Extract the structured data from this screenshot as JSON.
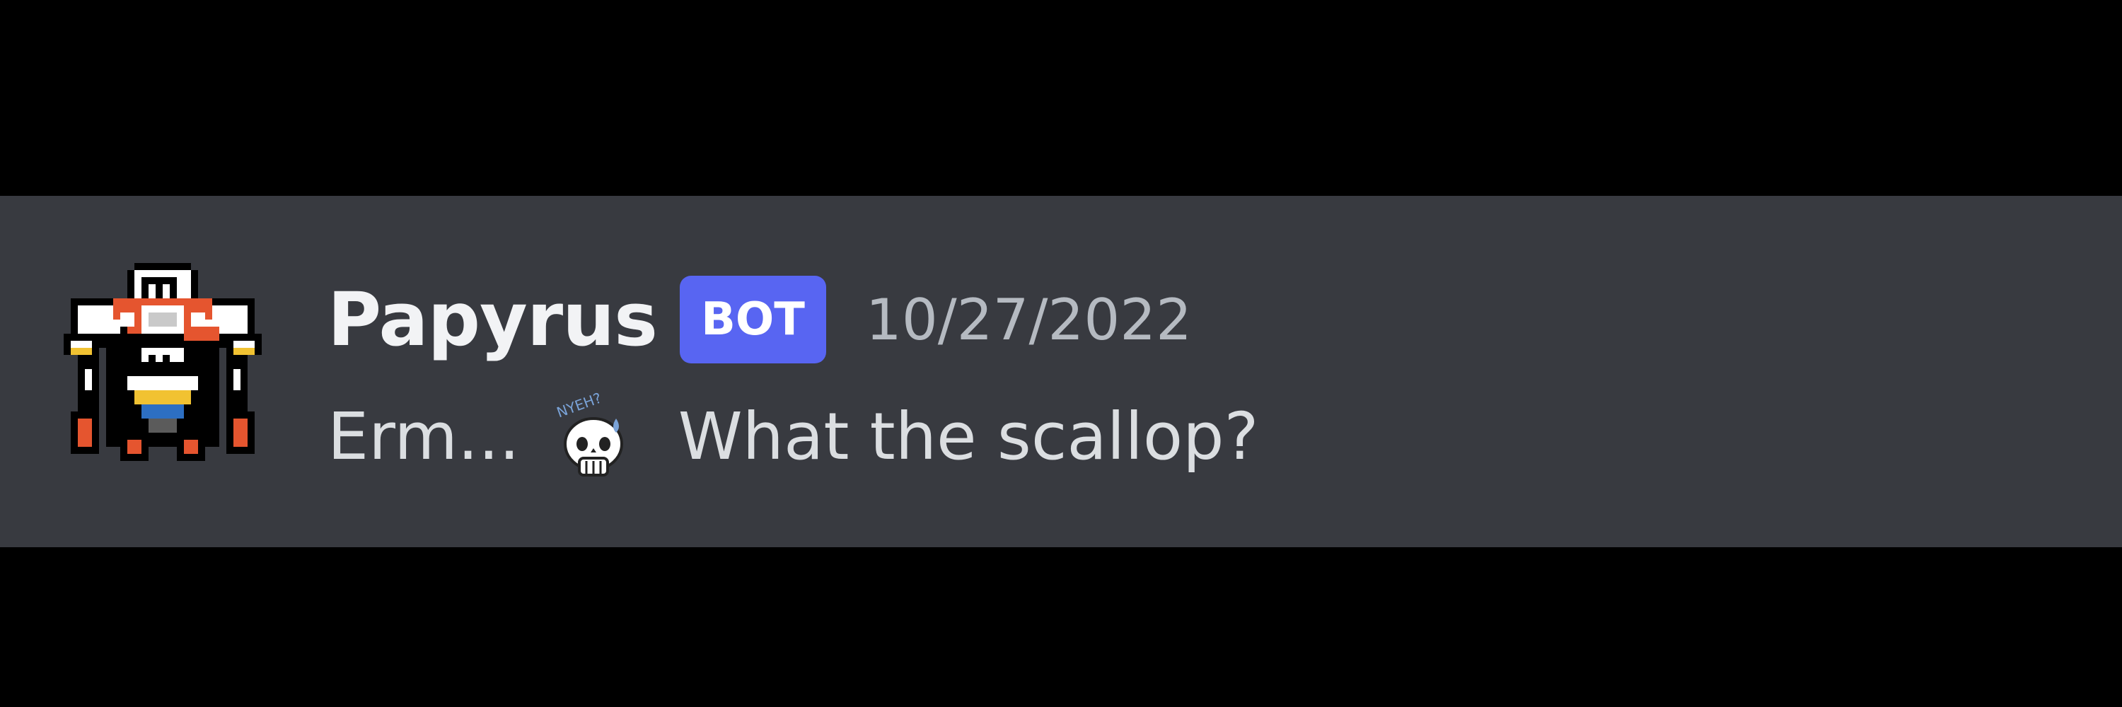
{
  "message": {
    "author": {
      "name": "Papyrus",
      "badge": "BOT",
      "avatar_icon": "papyrus-pixel-avatar"
    },
    "timestamp": "10/27/2022",
    "text_before": "Erm...",
    "emoji": {
      "icon": "papyrus-skull-emoji",
      "text": "NYEH?"
    },
    "text_after": "What the scallop?"
  },
  "colors": {
    "page_background": "#000000",
    "message_background": "#383a40",
    "username": "#f2f3f5",
    "bot_badge": "#5865f2",
    "timestamp": "#b5bac1",
    "message_text": "#dbdee1"
  }
}
